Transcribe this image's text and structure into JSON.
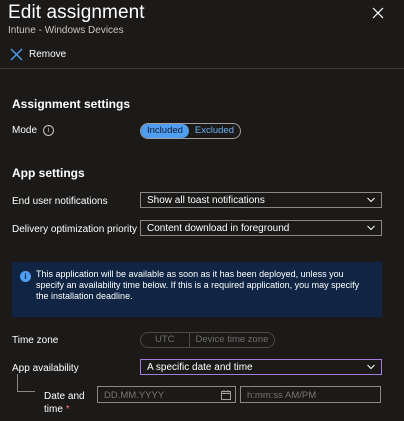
{
  "header": {
    "title": "Edit assignment",
    "subtitle": "Intune - Windows Devices"
  },
  "toolbar": {
    "remove_label": "Remove"
  },
  "assignment_settings": {
    "heading": "Assignment settings",
    "mode_label": "Mode",
    "mode_options": [
      "Included",
      "Excluded"
    ],
    "mode_selected": "Included"
  },
  "app_settings": {
    "heading": "App settings",
    "notifications_label": "End user notifications",
    "notifications_value": "Show all toast notifications",
    "delivery_label": "Delivery optimization priority",
    "delivery_value": "Content download in foreground"
  },
  "banner": {
    "text": "This application will be available as soon as it has been deployed, unless you specify an availability time below. If this is a required application, you may specify the installation deadline."
  },
  "timezone": {
    "label": "Time zone",
    "options": [
      "UTC",
      "Device time zone"
    ]
  },
  "availability": {
    "label": "App availability",
    "value": "A specific date and time"
  },
  "datetime": {
    "label_line1": "Date and",
    "label_line2": "time",
    "required_marker": "*",
    "date_placeholder": "DD.MM.YYYY",
    "time_placeholder": "h:mm:ss AM/PM"
  },
  "colors": {
    "background": "#1b1a19",
    "accent": "#4f9ef2",
    "banner": "#0f2543",
    "focus_border": "#a57ad8",
    "required": "#f1707b"
  }
}
